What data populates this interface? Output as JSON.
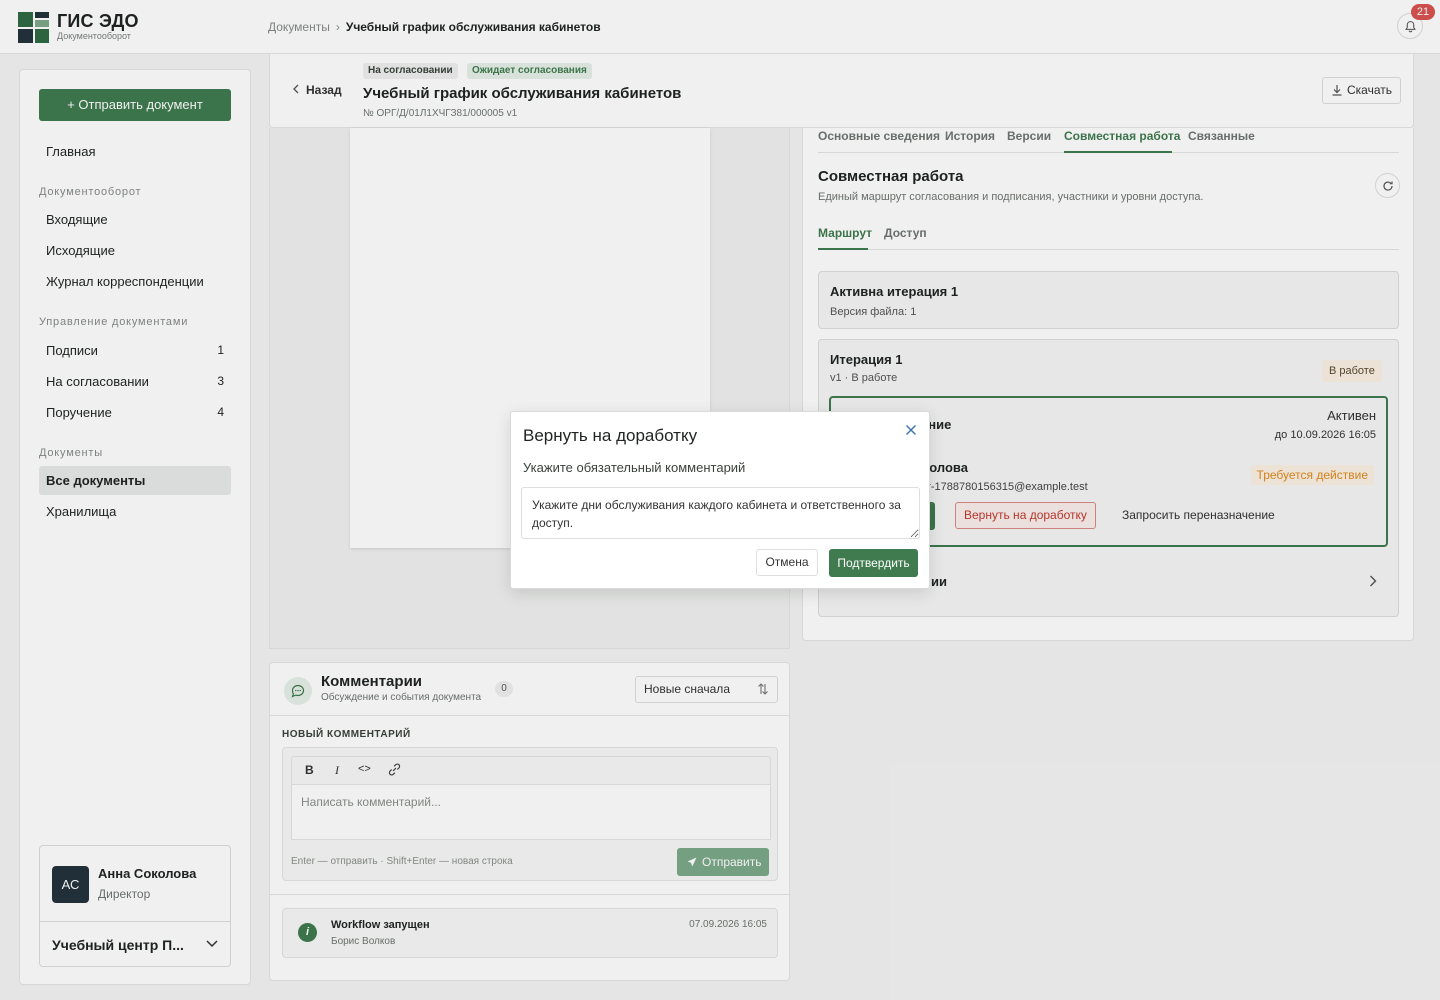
{
  "app": {
    "title": "ГИС ЭДО",
    "subtitle": "Документооборот"
  },
  "colors": {
    "accent": "#3f7b4f",
    "danger": "#c0392b",
    "warning": "#e08a1e"
  },
  "breadcrumb": {
    "root": "Документы",
    "separator": "›",
    "current": "Учебный график обслуживания кабинетов"
  },
  "notifications": {
    "count": "21",
    "icon": "bell-icon"
  },
  "sidebar": {
    "send_label": "Отправить документ",
    "home": "Главная",
    "sections": {
      "workflow": "Документооборот",
      "management": "Управление документами",
      "documents": "Документы"
    },
    "workflow_items": [
      {
        "label": "Входящие"
      },
      {
        "label": "Исходящие"
      },
      {
        "label": "Журнал корреспонденции"
      }
    ],
    "management_items": [
      {
        "label": "Подписи",
        "count": "1"
      },
      {
        "label": "На согласовании",
        "count": "3"
      },
      {
        "label": "Поручение",
        "count": "4"
      }
    ],
    "document_items": [
      {
        "label": "Все документы"
      },
      {
        "label": "Хранилища"
      }
    ],
    "user": {
      "initials": "АС",
      "name": "Анна Соколова",
      "role": "Директор",
      "org": "Учебный центр П..."
    }
  },
  "doc": {
    "back_label": "Назад",
    "tags": [
      "На согласовании",
      "Ожидает согласования"
    ],
    "title": "Учебный график обслуживания кабинетов",
    "number": "№ ОРГ/Д/01Л1ХЧГЗ81/000005  v1",
    "download_label": "Скачать"
  },
  "panel": {
    "tabs": [
      "Основные сведения",
      "История",
      "Версии",
      "Совместная работа",
      "Связанные"
    ],
    "title": "Совместная работа",
    "description": "Единый маршрут согласования и подписания, участники и уровни доступа.",
    "subtabs": [
      "Маршрут",
      "Доступ"
    ],
    "active_iteration": {
      "title": "Активна итерация 1",
      "file_version": "Версия файла: 1"
    },
    "iteration": {
      "title": "Итерация 1",
      "meta": "v1 · В работе",
      "status": "В работе",
      "stage": {
        "name": "ание",
        "status": "Активен",
        "due": "до 10.09.2026 16:05",
        "person": "околова",
        "email": "uer-1788780156315@example.test",
        "required": "Требуется действие",
        "rework_label": "Вернуть на доработку",
        "reassign_label": "Запросить переназначение"
      },
      "next_row": "ии"
    }
  },
  "comments": {
    "title": "Комментарии",
    "subtitle": "Обсуждение и события документа",
    "count": "0",
    "sort": "Новые сначала",
    "new_label": "НОВЫЙ КОММЕНТАРИЙ",
    "toolbar": {
      "bold": "B",
      "italic": "I",
      "code": "<>"
    },
    "placeholder": "Написать комментарий...",
    "hint": "Enter — отправить · Shift+Enter — новая строка",
    "send_label": "Отправить",
    "event": {
      "icon_glyph": "i",
      "title": "Workflow запущен",
      "user": "Борис Волков",
      "date": "07.09.2026 16:05"
    }
  },
  "modal": {
    "title": "Вернуть на доработку",
    "label": "Укажите обязательный комментарий",
    "comment": "Укажите дни обслуживания каждого кабинета и ответственного за доступ.",
    "cancel": "Отмена",
    "confirm": "Подтвердить"
  }
}
